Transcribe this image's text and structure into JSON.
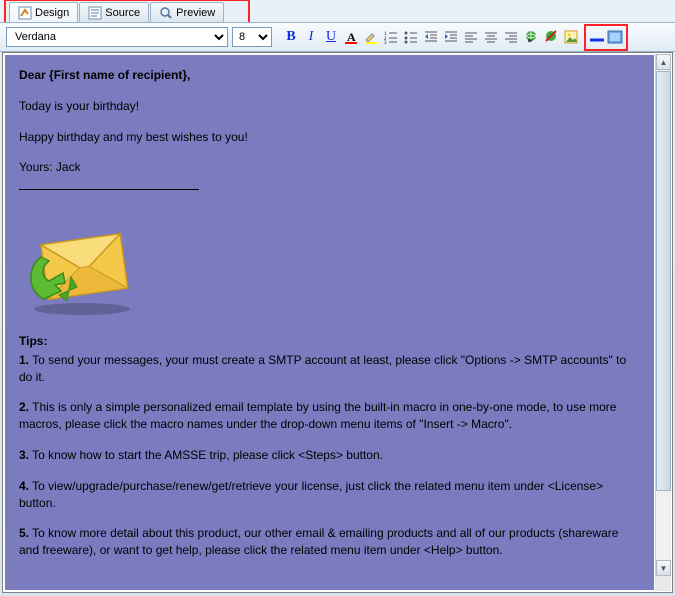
{
  "tabs": {
    "design": "Design",
    "source": "Source",
    "preview": "Preview"
  },
  "toolbar": {
    "font": "Verdana",
    "size": "8",
    "bold": "B",
    "italic": "I",
    "underline": "U",
    "fontcolor": "A"
  },
  "content": {
    "salutation": "Dear {First name of recipient},",
    "line1": "Today is your birthday!",
    "line2": "Happy birthday and my best wishes to you!",
    "signoff": "Yours: Jack",
    "tips_heading": "Tips:",
    "tip1_num": "1.",
    "tip1": " To send your messages, your must create a SMTP account at least, please click \"Options -> SMTP accounts\" to do it.",
    "tip2_num": "2.",
    "tip2": " This is only a simple personalized email template by using the built-in macro in one-by-one mode, to use more macros, please click the macro names under the drop-down menu items of \"Insert -> Macro\".",
    "tip3_num": "3.",
    "tip3": " To know how to start the AMSSE trip, please click <Steps> button.",
    "tip4_num": "4.",
    "tip4": " To view/upgrade/purchase/renew/get/retrieve your license, just click the related menu item under <License> button.",
    "tip5_num": "5.",
    "tip5": " To know more detail about this product, our other email & emailing products and all of our products (shareware and freeware), or want to get help, please click the related menu item under <Help> button."
  }
}
